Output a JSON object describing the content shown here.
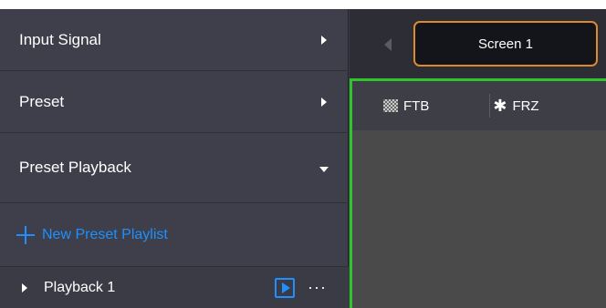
{
  "sidebar": {
    "items": [
      {
        "label": "Input Signal",
        "indicator": "chevron-right"
      },
      {
        "label": "Preset",
        "indicator": "chevron-right"
      },
      {
        "label": "Preset Playback",
        "indicator": "chevron-down"
      }
    ],
    "new_playlist_label": "New Preset Playlist",
    "playback": {
      "name": "Playback 1",
      "more": "···"
    }
  },
  "topbar": {
    "screen_tab": "Screen 1"
  },
  "toolbar": {
    "ftb_label": "FTB",
    "frz_label": "FRZ",
    "frz_icon": "✱"
  },
  "colors": {
    "accent_blue": "#1e90ff",
    "active_orange": "#e0892c",
    "canvas_green": "#2fc62c"
  }
}
